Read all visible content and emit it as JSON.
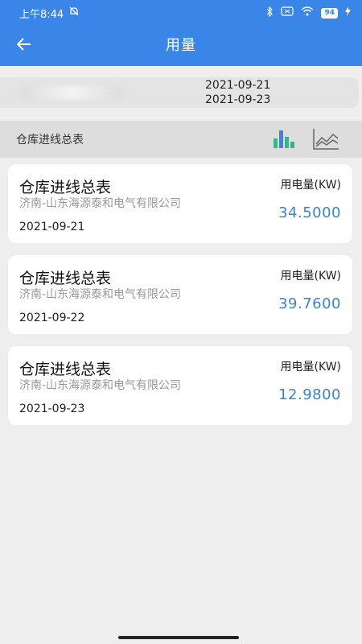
{
  "status_bar": {
    "time": "上午8:44",
    "battery": "94"
  },
  "header": {
    "title": "用量"
  },
  "date_range": {
    "start": "2021-09-21",
    "end": "2021-09-23"
  },
  "section": {
    "title": "仓库进线总表"
  },
  "icons": {
    "back": "arrow-left-icon",
    "bar_chart": "bar-chart-icon",
    "line_chart": "line-chart-icon"
  },
  "colors": {
    "header": "#3a86e8",
    "value": "#3d84c6",
    "bar_green": "#38b48b",
    "bar_blue": "#4a7fd6"
  },
  "records": [
    {
      "title": "仓库进线总表",
      "company": "济南-山东海源泰和电气有限公司",
      "date": "2021-09-21",
      "usage_label": "用电量(KW)",
      "value": "34.5000"
    },
    {
      "title": "仓库进线总表",
      "company": "济南-山东海源泰和电气有限公司",
      "date": "2021-09-22",
      "usage_label": "用电量(KW)",
      "value": "39.7600"
    },
    {
      "title": "仓库进线总表",
      "company": "济南-山东海源泰和电气有限公司",
      "date": "2021-09-23",
      "usage_label": "用电量(KW)",
      "value": "12.9800"
    }
  ]
}
